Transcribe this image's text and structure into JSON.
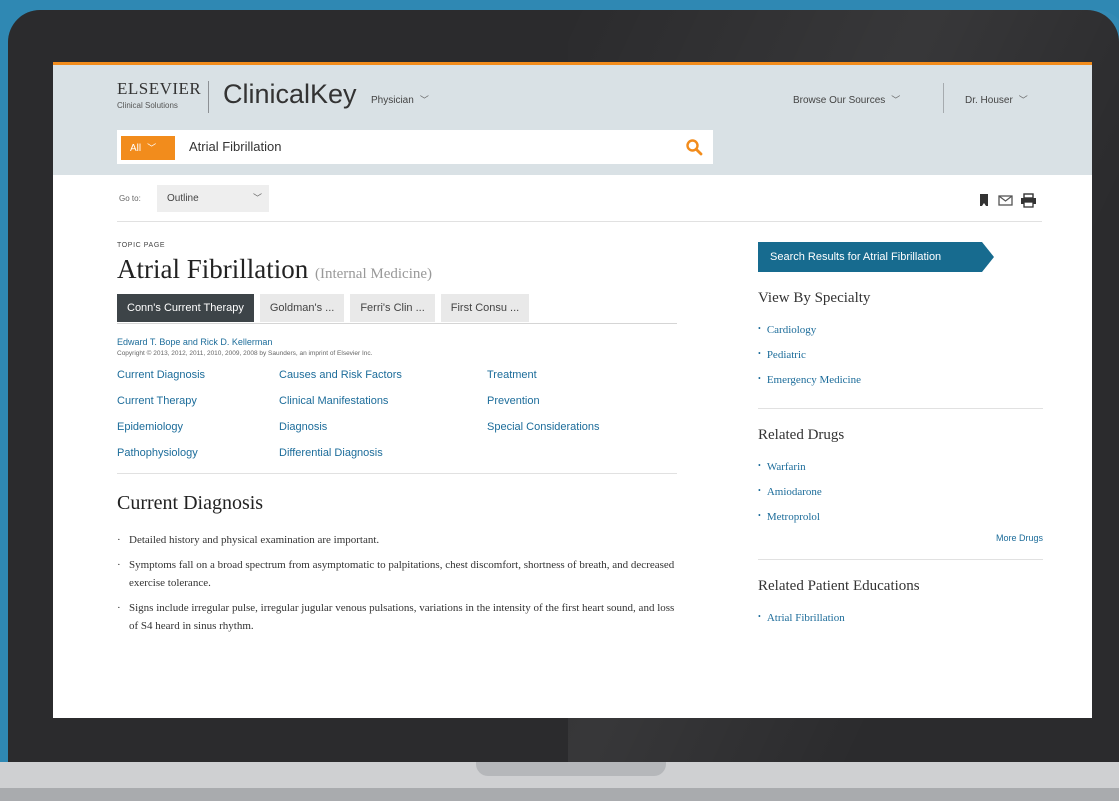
{
  "header": {
    "publisher": "ELSEVIER",
    "publisher_sub": "Clinical Solutions",
    "product": "ClinicalKey",
    "role": "Physician",
    "browse_label": "Browse Our Sources",
    "user": "Dr. Houser",
    "accent_color": "#f28c1c"
  },
  "search": {
    "scope": "All",
    "query": "Atrial Fibrillation",
    "icon": "search-icon"
  },
  "toolbar": {
    "goto_label": "Go to:",
    "goto_value": "Outline",
    "icons": [
      "bookmark-icon",
      "email-icon",
      "print-icon"
    ]
  },
  "topic": {
    "kicker": "TOPIC PAGE",
    "title": "Atrial Fibrillation",
    "subtitle": "(Internal Medicine)",
    "tabs": [
      {
        "label": "Conn's Current Therapy",
        "active": true
      },
      {
        "label": "Goldman's ...",
        "active": false
      },
      {
        "label": "Ferri's Clin ...",
        "active": false
      },
      {
        "label": "First Consu ...",
        "active": false
      }
    ],
    "authors": "Edward T. Bope and Rick D. Kellerman",
    "copyright": "Copyright © 2013, 2012, 2011, 2010, 2009, 2008 by Saunders, an imprint of Elsevier Inc.",
    "links": [
      [
        "Current Diagnosis",
        "Current Therapy",
        "Epidemiology",
        "Pathophysiology"
      ],
      [
        "Causes and Risk Factors",
        "Clinical Manifestations",
        "Diagnosis",
        "Differential Diagnosis"
      ],
      [
        "Treatment",
        "Prevention",
        "Special Considerations"
      ]
    ],
    "section_title": "Current Diagnosis",
    "bullets": [
      "Detailed history and physical examination are important.",
      "Symptoms fall on a broad spectrum from asymptomatic to palpitations, chest discomfort, shortness of breath, and decreased exercise tolerance.",
      "Signs include irregular pulse, irregular jugular venous pulsations, variations in the intensity of the first heart sound, and loss of S4 heard in sinus rhythm."
    ]
  },
  "sidebar": {
    "results_button": "Search Results for Atrial Fibrillation",
    "specialty_heading": "View By Specialty",
    "specialties": [
      "Cardiology",
      "Pediatric",
      "Emergency Medicine"
    ],
    "drugs_heading": "Related Drugs",
    "drugs": [
      "Warfarin",
      "Amiodarone",
      "Metroprolol"
    ],
    "more_drugs": "More Drugs",
    "education_heading": "Related Patient Educations",
    "educations": [
      "Atrial Fibrillation"
    ]
  }
}
